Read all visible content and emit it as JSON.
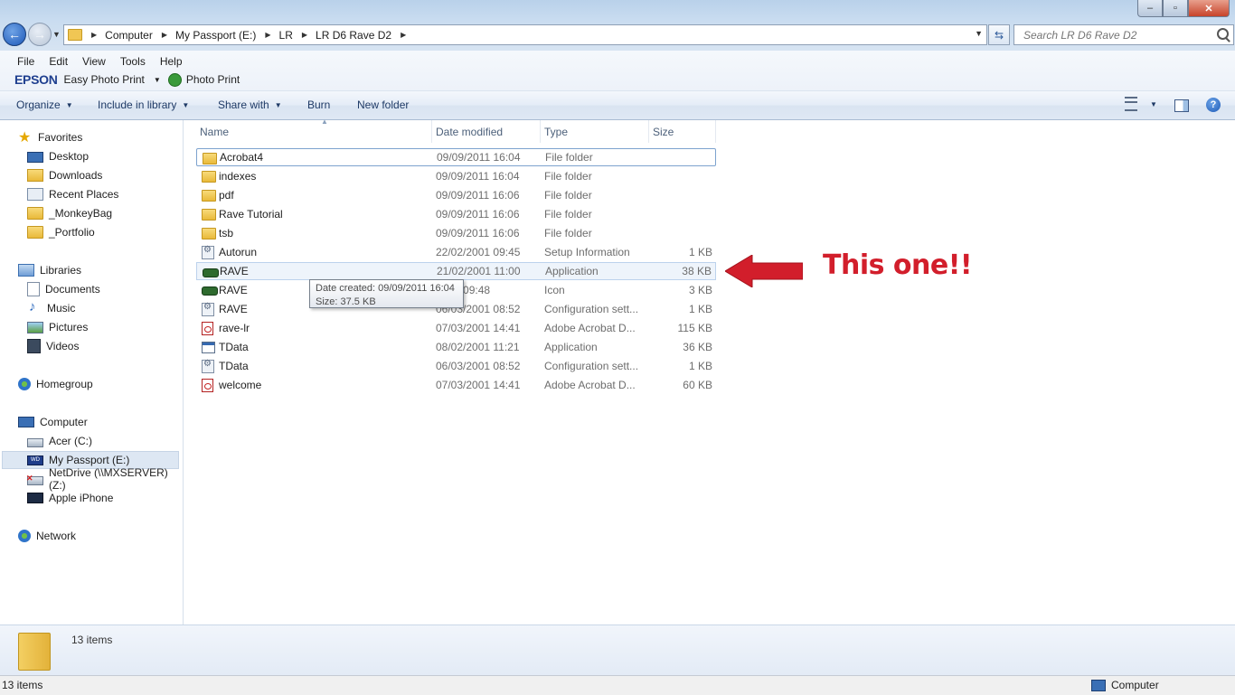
{
  "window": {
    "controls": {
      "minimize": "–",
      "maximize": "▫",
      "close": "✕"
    }
  },
  "address": {
    "crumbs": [
      "Computer",
      "My Passport (E:)",
      "LR",
      "LR D6 Rave D2"
    ]
  },
  "search": {
    "placeholder": "Search LR D6 Rave D2"
  },
  "menubar": {
    "items": [
      "File",
      "Edit",
      "View",
      "Tools",
      "Help"
    ]
  },
  "epson": {
    "logo": "EPSON",
    "easy_photo_print": "Easy Photo Print",
    "photo_print": "Photo Print"
  },
  "toolbar": {
    "organize": "Organize",
    "include_in_library": "Include in library",
    "share_with": "Share with",
    "burn": "Burn",
    "new_folder": "New folder"
  },
  "nav": {
    "favorites": "Favorites",
    "desktop": "Desktop",
    "downloads": "Downloads",
    "recent_places": "Recent Places",
    "monkeybag": "_MonkeyBag",
    "portfolio": "_Portfolio",
    "libraries": "Libraries",
    "documents": "Documents",
    "music": "Music",
    "pictures": "Pictures",
    "videos": "Videos",
    "homegroup": "Homegroup",
    "computer": "Computer",
    "acer": "Acer (C:)",
    "my_passport": "My Passport (E:)",
    "netdrive": "NetDrive (\\\\MXSERVER) (Z:)",
    "apple_iphone": "Apple iPhone",
    "network": "Network"
  },
  "columns": {
    "name": "Name",
    "date_modified": "Date modified",
    "type": "Type",
    "size": "Size"
  },
  "files": [
    {
      "name": "Acrobat4",
      "date": "09/09/2011 16:04",
      "type": "File folder",
      "size": "",
      "icon": "folder-icon"
    },
    {
      "name": "indexes",
      "date": "09/09/2011 16:04",
      "type": "File folder",
      "size": "",
      "icon": "folder-icon"
    },
    {
      "name": "pdf",
      "date": "09/09/2011 16:06",
      "type": "File folder",
      "size": "",
      "icon": "folder-icon"
    },
    {
      "name": "Rave Tutorial",
      "date": "09/09/2011 16:06",
      "type": "File folder",
      "size": "",
      "icon": "folder-icon"
    },
    {
      "name": "tsb",
      "date": "09/09/2011 16:06",
      "type": "File folder",
      "size": "",
      "icon": "folder-icon"
    },
    {
      "name": "Autorun",
      "date": "22/02/2001 09:45",
      "type": "Setup Information",
      "size": "1 KB",
      "icon": "setup-file-icon"
    },
    {
      "name": "RAVE",
      "date": "21/02/2001 11:00",
      "type": "Application",
      "size": "38 KB",
      "icon": "application-icon"
    },
    {
      "name": "RAVE",
      "date": "2001 09:48",
      "type": "Icon",
      "size": "3 KB",
      "icon": "application-icon"
    },
    {
      "name": "RAVE",
      "date": "06/03/2001 08:52",
      "type": "Configuration sett...",
      "size": "1 KB",
      "icon": "setup-file-icon"
    },
    {
      "name": "rave-lr",
      "date": "07/03/2001 14:41",
      "type": "Adobe Acrobat D...",
      "size": "115 KB",
      "icon": "pdf-icon"
    },
    {
      "name": "TData",
      "date": "08/02/2001 11:21",
      "type": "Application",
      "size": "36 KB",
      "icon": "application-window-icon"
    },
    {
      "name": "TData",
      "date": "06/03/2001 08:52",
      "type": "Configuration sett...",
      "size": "1 KB",
      "icon": "setup-file-icon"
    },
    {
      "name": "welcome",
      "date": "07/03/2001 14:41",
      "type": "Adobe Acrobat D...",
      "size": "60 KB",
      "icon": "pdf-icon"
    }
  ],
  "tooltip": {
    "line1": "Date created: 09/09/2011 16:04",
    "line2": "Size: 37.5 KB"
  },
  "annotation": {
    "text": "This one!!",
    "color": "#d21e2b"
  },
  "details": {
    "count": "13 items"
  },
  "statusbar": {
    "count": "13 items",
    "location": "Computer"
  }
}
